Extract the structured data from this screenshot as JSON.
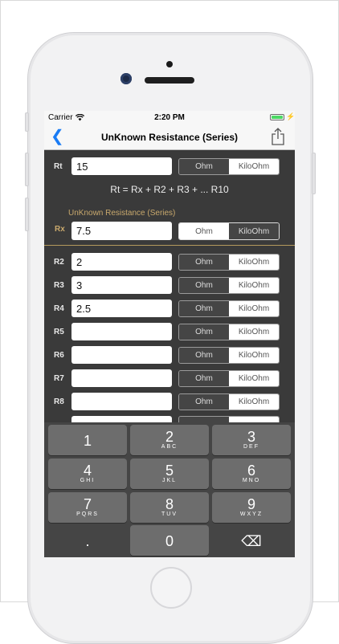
{
  "status": {
    "carrier": "Carrier",
    "time": "2:20 PM"
  },
  "nav": {
    "title": "UnKnown Resistance (Series)"
  },
  "rt": {
    "label": "Rt",
    "value": "15"
  },
  "formula": "Rt = Rx + R2 + R3 + ... R10",
  "rx_section": {
    "title": "UnKnown Resistance (Series)",
    "label": "Rx",
    "value": "7.5"
  },
  "units": {
    "ohm": "Ohm",
    "kiloohm": "KiloOhm"
  },
  "resistors": [
    {
      "label": "R2",
      "value": "2"
    },
    {
      "label": "R3",
      "value": "3"
    },
    {
      "label": "R4",
      "value": "2.5"
    },
    {
      "label": "R5",
      "value": ""
    },
    {
      "label": "R6",
      "value": ""
    },
    {
      "label": "R7",
      "value": ""
    },
    {
      "label": "R8",
      "value": ""
    }
  ],
  "keyboard": {
    "keys": [
      {
        "num": "1",
        "letters": ""
      },
      {
        "num": "2",
        "letters": "ABC"
      },
      {
        "num": "3",
        "letters": "DEF"
      },
      {
        "num": "4",
        "letters": "GHI"
      },
      {
        "num": "5",
        "letters": "JKL"
      },
      {
        "num": "6",
        "letters": "MNO"
      },
      {
        "num": "7",
        "letters": "PQRS"
      },
      {
        "num": "8",
        "letters": "TUV"
      },
      {
        "num": "9",
        "letters": "WXYZ"
      },
      {
        "num": ".",
        "letters": ""
      },
      {
        "num": "0",
        "letters": ""
      },
      {
        "num": "⌫",
        "letters": ""
      }
    ]
  },
  "colors": {
    "accent": "#1a7cf5",
    "gold": "#c9a96d",
    "panel": "#3a3a3a"
  },
  "icons": {
    "back": "chevron-left-icon",
    "share": "share-icon",
    "wifi": "wifi-icon",
    "battery": "battery-icon",
    "delete": "backspace-icon"
  }
}
